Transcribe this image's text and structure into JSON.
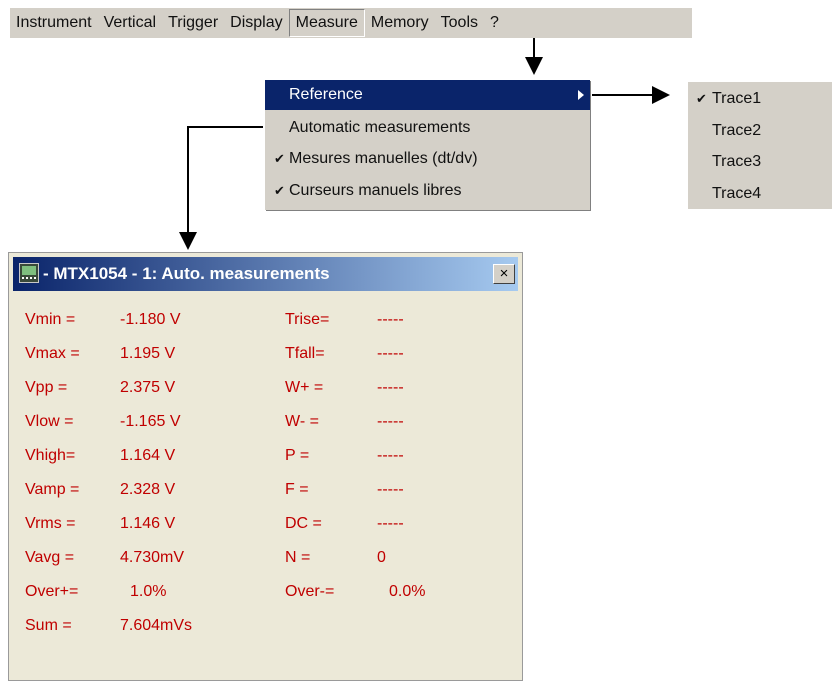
{
  "menubar": {
    "items": [
      "Instrument",
      "Vertical",
      "Trigger",
      "Display",
      "Measure",
      "Memory",
      "Tools",
      "?"
    ],
    "active": "Measure"
  },
  "measure_menu": {
    "items": [
      {
        "label": "Reference",
        "checked": false,
        "selected": true,
        "has_submenu": true
      },
      {
        "label": "Automatic measurements",
        "checked": false,
        "selected": false
      },
      {
        "label": "Mesures manuelles (dt/dv)",
        "checked": true,
        "selected": false
      },
      {
        "label": "Curseurs manuels libres",
        "checked": true,
        "selected": false
      }
    ]
  },
  "reference_submenu": {
    "items": [
      {
        "label": "Trace1",
        "checked": true
      },
      {
        "label": "Trace2",
        "checked": false
      },
      {
        "label": "Trace3",
        "checked": false
      },
      {
        "label": "Trace4",
        "checked": false
      }
    ]
  },
  "window": {
    "title": "- MTX1054 - 1: Auto. measurements",
    "close_label": "×",
    "left_column": [
      {
        "label": "Vmin =",
        "value": "-1.180 V"
      },
      {
        "label": "Vmax =",
        "value": "1.195 V"
      },
      {
        "label": "Vpp  =",
        "value": "2.375 V"
      },
      {
        "label": "Vlow =",
        "value": "-1.165 V"
      },
      {
        "label": "Vhigh=",
        "value": "1.164 V"
      },
      {
        "label": "Vamp =",
        "value": "2.328 V"
      },
      {
        "label": "Vrms =",
        "value": "1.146 V"
      },
      {
        "label": "Vavg =",
        "value": "4.730mV"
      },
      {
        "label": "Over+=",
        "value": "1.0%"
      },
      {
        "label": "Sum  =",
        "value": "7.604mVs"
      }
    ],
    "right_column": [
      {
        "label": "Trise=",
        "value": "-----"
      },
      {
        "label": "Tfall=",
        "value": "-----"
      },
      {
        "label": "W+  =",
        "value": "-----"
      },
      {
        "label": "W-  =",
        "value": "-----"
      },
      {
        "label": "P   =",
        "value": "-----"
      },
      {
        "label": "F   =",
        "value": "-----"
      },
      {
        "label": "DC  =",
        "value": "-----"
      },
      {
        "label": "N   =",
        "value": "0"
      },
      {
        "label": "Over-=",
        "value": "0.0%"
      }
    ]
  },
  "colors": {
    "menu_bg": "#d4d0c8",
    "highlight": "#0a246a",
    "window_bg": "#ece9d8",
    "measure_text": "#c00000"
  }
}
